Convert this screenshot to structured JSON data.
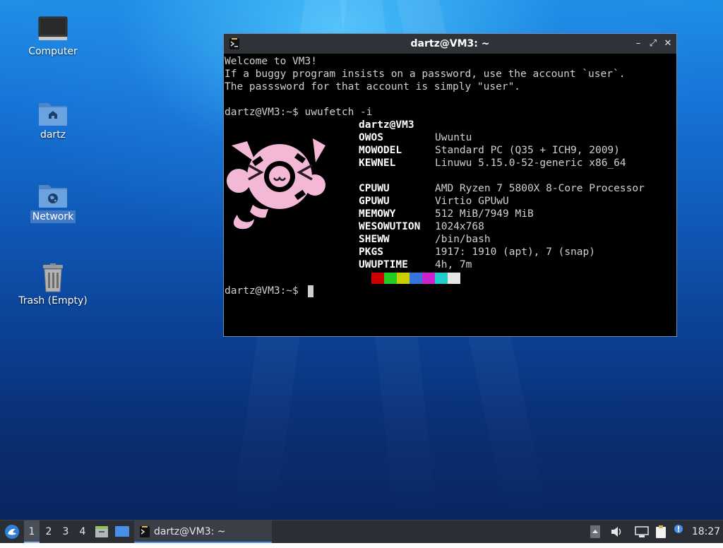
{
  "desktop": {
    "icons": [
      {
        "label": "Computer"
      },
      {
        "label": "dartz"
      },
      {
        "label": "Network"
      },
      {
        "label": "Trash (Empty)"
      }
    ]
  },
  "terminal": {
    "title": "dartz@VM3: ~",
    "controls": {
      "minimize": "–",
      "maximize": "⤢",
      "close": "✕"
    },
    "motd": [
      "Welcome to VM3!",
      "If a buggy program insists on a password, use the account `user`.",
      "The passsword for that account is simply \"user\"."
    ],
    "command_prompt": "dartz@VM3:~$ uwufetch -i",
    "user_host": "dartz@VM3",
    "info": [
      {
        "key": "OWOS",
        "value": "Uwuntu"
      },
      {
        "key": "MOWODEL",
        "value": "Standard PC (Q35 + ICH9, 2009)"
      },
      {
        "key": "KEWNEL",
        "value": "Linuwu 5.15.0-52-generic x86_64"
      },
      {
        "key": "CPUWU",
        "value": "AMD Ryzen 7 5800X 8-Core Processor"
      },
      {
        "key": "GPUWU",
        "value": "Virtio GPUwU"
      },
      {
        "key": "MEMOWY",
        "value": "512 MiB/7949 MiB"
      },
      {
        "key": "WESOWUTION",
        "value": "1024x768"
      },
      {
        "key": "SHEWW",
        "value": "/bin/bash"
      },
      {
        "key": "PKGS",
        "value": "1917: 1910 (apt), 7 (snap)"
      },
      {
        "key": "UWUPTIME",
        "value": "4h, 7m"
      }
    ],
    "palette": [
      "#cc0000",
      "#22cc22",
      "#cccc00",
      "#3377dd",
      "#cc22cc",
      "#22cccc",
      "#e6e6e6"
    ],
    "final_prompt": "dartz@VM3:~$"
  },
  "taskbar": {
    "workspaces": [
      "1",
      "2",
      "3",
      "4"
    ],
    "active_workspace": "1",
    "task_title": "dartz@VM3: ~",
    "clock": "18:27"
  }
}
